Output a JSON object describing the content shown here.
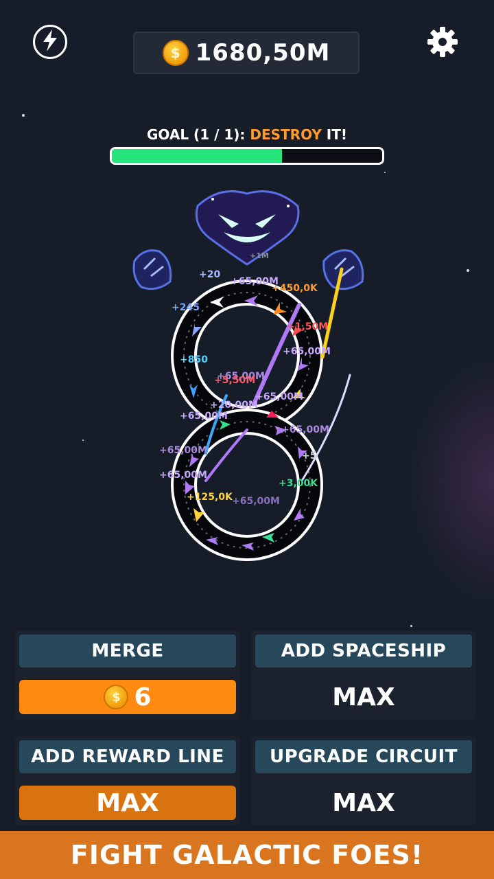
{
  "header": {
    "coin_amount": "1680,50M",
    "coin_symbol": "$",
    "boost_icon": "lightning-icon",
    "settings_icon": "gear-icon"
  },
  "goal": {
    "prefix": "GOAL (1 / 1): ",
    "highlight": "DESTROY",
    "suffix": " IT!",
    "progress": 0.63,
    "fill_color": "#25e47b"
  },
  "floating_rewards": [
    "+20",
    "+65,00M",
    "+450,0K",
    "+245",
    "+1,50M",
    "+65,00M",
    "+850",
    "+65,00M",
    "+5,50M",
    "+65,00M",
    "+20,00M",
    "+65,00M",
    "+65,00M",
    "+65,00M",
    "+5",
    "+65,00M",
    "+3,00K",
    "+125,0K",
    "+65,00M",
    "+1M"
  ],
  "upgrades": {
    "merge": {
      "title": "MERGE",
      "cost": "6",
      "coin_symbol": "$"
    },
    "add_spaceship": {
      "title": "ADD SPACESHIP",
      "value": "MAX"
    },
    "add_reward_line": {
      "title": "ADD REWARD LINE",
      "value": "MAX"
    },
    "upgrade_circuit": {
      "title": "UPGRADE CIRCUIT",
      "value": "MAX"
    }
  },
  "footer": {
    "text": "FIGHT GALACTIC FOES!"
  },
  "colors": {
    "accent_orange": "#ff8a12",
    "panel_header": "#27475b",
    "footer": "#d9751f",
    "highlight": "#ff9a2e"
  }
}
